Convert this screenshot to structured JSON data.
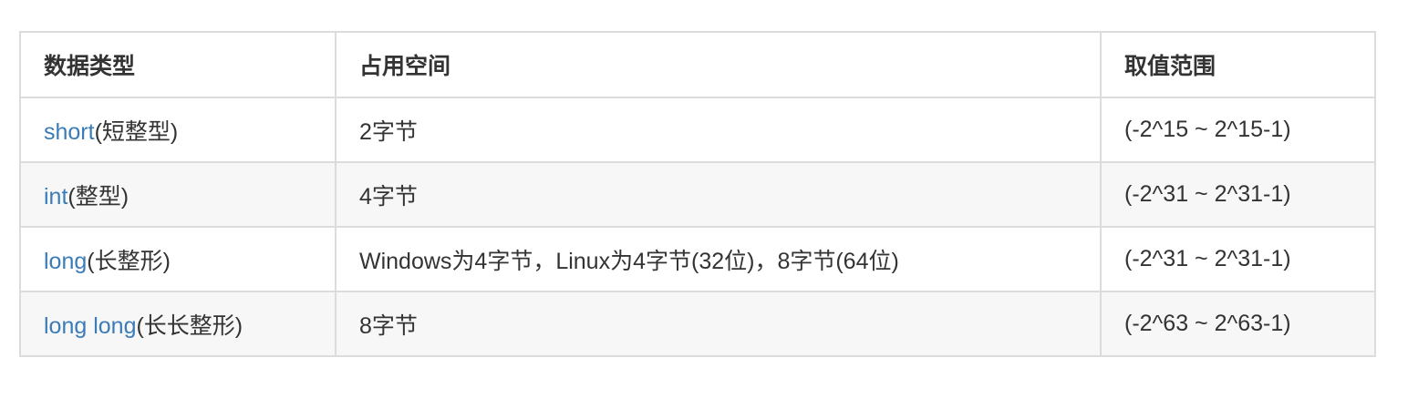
{
  "table": {
    "headers": [
      "数据类型",
      "占用空间",
      "取值范围"
    ],
    "rows": [
      {
        "type_kw": "short",
        "type_note": "(短整型)",
        "size": "2字节",
        "range": "(-2^15 ~ 2^15-1)"
      },
      {
        "type_kw": "int",
        "type_note": "(整型)",
        "size": "4字节",
        "range": "(-2^31 ~ 2^31-1)"
      },
      {
        "type_kw": "long",
        "type_note": "(长整形)",
        "size": "Windows为4字节，Linux为4字节(32位)，8字节(64位)",
        "range": "(-2^31 ~ 2^31-1)"
      },
      {
        "type_kw": "long long",
        "type_note": "(长长整形)",
        "size": "8字节",
        "range": "(-2^63 ~ 2^63-1)"
      }
    ]
  },
  "colors": {
    "keyword": "#3a7cb8",
    "text": "#333333",
    "border": "#dcdcdc",
    "stripe": "#f7f7f7"
  }
}
